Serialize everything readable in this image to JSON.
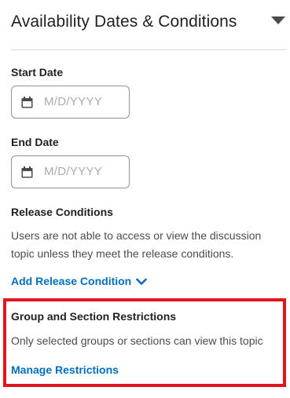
{
  "header": {
    "title": "Availability Dates & Conditions"
  },
  "start_date": {
    "label": "Start Date",
    "placeholder": "M/D/YYYY"
  },
  "end_date": {
    "label": "End Date",
    "placeholder": "M/D/YYYY"
  },
  "release_conditions": {
    "label": "Release Conditions",
    "description": "Users are not able to access or view the discussion topic unless they meet the release conditions.",
    "add_link": "Add Release Condition"
  },
  "restrictions": {
    "label": "Group and Section Restrictions",
    "description": "Only selected groups or sections can view this topic",
    "manage_link": "Manage Restrictions"
  },
  "colors": {
    "link": "#006fbf",
    "highlight_border": "#e2141d",
    "text": "#202122",
    "placeholder": "#a6acb2"
  },
  "icons": {
    "collapse": "triangle-down-icon",
    "calendar": "calendar-icon",
    "add_chevron": "chevron-down-icon"
  }
}
